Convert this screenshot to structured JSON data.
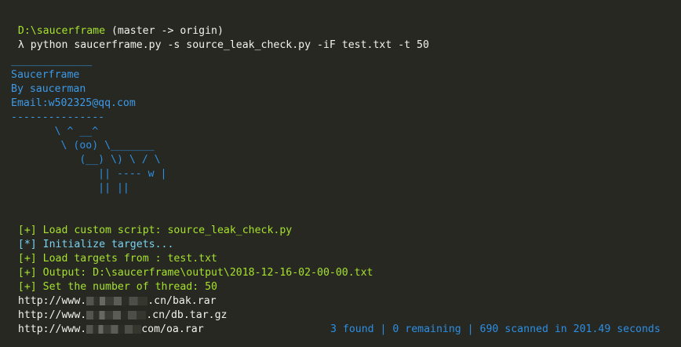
{
  "prompt": {
    "path": "D:\\saucerframe",
    "branch": " (master -> origin)",
    "symbol": "λ",
    "command": " python saucerframe.py -s source_leak_check.py -iF test.txt -t 50"
  },
  "banner": {
    "top_rule": "_____________",
    "name": "Saucerframe",
    "author": "By saucerman",
    "email": "Email:w502325@qq.com",
    "bottom_rule": "---------------",
    "art": [
      "       \\ ^ __^",
      "        \\ (oo) \\_______",
      "           (__) \\) \\ / \\",
      "              || ---- w |",
      "              || ||"
    ]
  },
  "messages": [
    {
      "tag": "[+]",
      "text": " Load custom script: source_leak_check.py",
      "tag_color": "#a6e22e",
      "text_color": "#a6e22e"
    },
    {
      "tag": "[*]",
      "text": " Initialize targets...",
      "tag_color": "#79d2f2",
      "text_color": "#79d2f2"
    },
    {
      "tag": "[+]",
      "text": " Load targets from : test.txt",
      "tag_color": "#a6e22e",
      "text_color": "#a6e22e"
    },
    {
      "tag": "[+]",
      "text": " Output: D:\\saucerframe\\output\\2018-12-16-02-00-00.txt",
      "tag_color": "#a6e22e",
      "text_color": "#a6e22e"
    },
    {
      "tag": "[+]",
      "text": " Set the number of thread: 50",
      "tag_color": "#a6e22e",
      "text_color": "#a6e22e"
    }
  ],
  "results": [
    {
      "prefix": "http://www.",
      "suffix": ".cn/bak.rar"
    },
    {
      "prefix": "http://www.",
      "suffix": ".cn/db.tar.gz"
    },
    {
      "prefix": "http://www.",
      "suffix": "com/oa.rar"
    }
  ],
  "status": {
    "text": "3 found | 0 remaining | 690 scanned in 201.49 seconds"
  },
  "colors": {
    "background": "#272822",
    "path": "#a6e22e",
    "banner": "#3d9ae8",
    "status": "#2c8ee4"
  }
}
